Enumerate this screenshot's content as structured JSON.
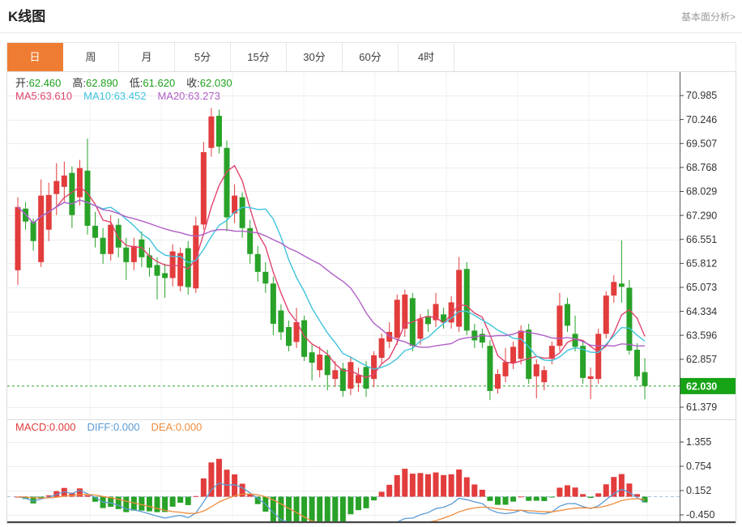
{
  "header": {
    "title": "K线图",
    "link_label": "基本面分析>"
  },
  "tabs": [
    {
      "key": "day",
      "label": "日",
      "active": true
    },
    {
      "key": "week",
      "label": "周",
      "active": false
    },
    {
      "key": "month",
      "label": "月",
      "active": false
    },
    {
      "key": "5min",
      "label": "5分",
      "active": false
    },
    {
      "key": "15min",
      "label": "15分",
      "active": false
    },
    {
      "key": "30min",
      "label": "30分",
      "active": false
    },
    {
      "key": "60min",
      "label": "60分",
      "active": false
    },
    {
      "key": "4hour",
      "label": "4时",
      "active": false
    }
  ],
  "quote_bar": [
    {
      "label": "开:",
      "value": "62.460"
    },
    {
      "label": "高:",
      "value": "62.890"
    },
    {
      "label": "低:",
      "value": "61.620"
    },
    {
      "label": "收:",
      "value": "62.030"
    }
  ],
  "ma_bar": [
    {
      "label": "MA5:",
      "value": "63.610",
      "color": "#e0446e"
    },
    {
      "label": "MA10:",
      "value": "63.452",
      "color": "#3ec3dc"
    },
    {
      "label": "MA20:",
      "value": "63.273",
      "color": "#b05fc6"
    }
  ],
  "macd_bar": [
    {
      "label": "MACD:",
      "value": "0.000",
      "color": "#e23c3c"
    },
    {
      "label": "DIFF:",
      "value": "0.000",
      "color": "#5b9bd5"
    },
    {
      "label": "DEA:",
      "value": "0.000",
      "color": "#f08c3c"
    }
  ],
  "colors": {
    "up": "#e23c3c",
    "down": "#28a228",
    "value_green": "#1ba11b",
    "badge_green": "#16a316",
    "tab_active": "#ee7d33",
    "axis": "#555555",
    "grid": "#ededed",
    "vgrid": "#f3f3f3",
    "ref_dash": "#2aa22a",
    "zero_dash": "#a9c4e4"
  },
  "chart_data": {
    "type": "candlestick",
    "title": "K线图 (daily K-line with MA5/MA10/MA20 and MACD sub-chart)",
    "y_axis": {
      "ticks": [
        "70.985",
        "70.246",
        "69.507",
        "68.768",
        "68.029",
        "67.290",
        "66.551",
        "65.812",
        "65.073",
        "64.334",
        "63.596",
        "62.857",
        "61.379"
      ],
      "current_price_badge": "62.030"
    },
    "reference_price": 62.03,
    "last_bar": {
      "open": 62.46,
      "high": 62.89,
      "low": 61.62,
      "close": 62.03
    },
    "candles_format": [
      "open",
      "high",
      "low",
      "close"
    ],
    "candles": [
      [
        65.6,
        67.85,
        65.15,
        67.55
      ],
      [
        67.5,
        67.7,
        66.85,
        67.1
      ],
      [
        67.1,
        67.2,
        66.2,
        66.5
      ],
      [
        65.85,
        68.4,
        65.7,
        67.9
      ],
      [
        66.85,
        68.3,
        66.5,
        67.92
      ],
      [
        67.95,
        68.9,
        67.3,
        68.35
      ],
      [
        68.17,
        68.95,
        67.72,
        68.52
      ],
      [
        68.6,
        68.8,
        66.9,
        67.3
      ],
      [
        67.85,
        69.0,
        67.6,
        68.75
      ],
      [
        68.67,
        69.66,
        66.7,
        66.97
      ],
      [
        66.97,
        67.4,
        66.3,
        66.6
      ],
      [
        66.6,
        66.9,
        65.8,
        66.1
      ],
      [
        66.1,
        67.3,
        65.9,
        67.0
      ],
      [
        67.0,
        67.2,
        66.0,
        66.3
      ],
      [
        66.3,
        66.6,
        65.3,
        65.85
      ],
      [
        65.85,
        66.6,
        65.6,
        66.35
      ],
      [
        66.55,
        66.8,
        65.7,
        66.0
      ],
      [
        66.06,
        66.3,
        65.4,
        65.68
      ],
      [
        65.76,
        66.0,
        64.7,
        65.43
      ],
      [
        65.51,
        65.8,
        64.75,
        65.36
      ],
      [
        65.36,
        66.4,
        65.1,
        66.18
      ],
      [
        65.11,
        66.3,
        64.95,
        66.13
      ],
      [
        66.28,
        66.5,
        64.85,
        65.08
      ],
      [
        65.04,
        67.25,
        64.9,
        66.98
      ],
      [
        67.01,
        69.55,
        66.85,
        69.24
      ],
      [
        69.37,
        70.6,
        69.1,
        70.34
      ],
      [
        70.36,
        70.55,
        69.2,
        69.41
      ],
      [
        69.37,
        69.6,
        66.8,
        67.23
      ],
      [
        67.35,
        68.25,
        67.05,
        67.9
      ],
      [
        67.85,
        68.0,
        66.6,
        66.9
      ],
      [
        66.9,
        67.15,
        65.8,
        66.1
      ],
      [
        66.1,
        66.35,
        65.25,
        65.55
      ],
      [
        65.55,
        65.85,
        64.9,
        65.19
      ],
      [
        65.19,
        65.4,
        63.6,
        63.95
      ],
      [
        64.36,
        64.55,
        63.45,
        63.69
      ],
      [
        63.85,
        64.05,
        63.1,
        63.27
      ],
      [
        63.39,
        64.44,
        63.2,
        64.0
      ],
      [
        64.06,
        64.2,
        62.8,
        62.93
      ],
      [
        63.07,
        63.3,
        62.2,
        62.75
      ],
      [
        62.52,
        63.25,
        62.3,
        63.0
      ],
      [
        62.98,
        63.15,
        61.9,
        62.37
      ],
      [
        62.25,
        62.8,
        62.0,
        62.52
      ],
      [
        62.57,
        62.75,
        61.7,
        61.88
      ],
      [
        61.95,
        62.95,
        61.75,
        62.77
      ],
      [
        62.12,
        62.6,
        61.85,
        62.37
      ],
      [
        62.62,
        62.8,
        61.7,
        61.95
      ],
      [
        62.25,
        63.1,
        62.0,
        62.98
      ],
      [
        62.9,
        63.65,
        62.7,
        63.5
      ],
      [
        63.4,
        64.0,
        63.2,
        63.7
      ],
      [
        63.52,
        64.85,
        63.3,
        64.69
      ],
      [
        63.8,
        65.0,
        63.55,
        64.85
      ],
      [
        64.74,
        64.9,
        63.1,
        63.27
      ],
      [
        63.49,
        64.25,
        63.3,
        64.11
      ],
      [
        64.19,
        64.4,
        63.7,
        63.94
      ],
      [
        64.06,
        64.9,
        63.85,
        64.56
      ],
      [
        64.24,
        64.45,
        63.8,
        63.99
      ],
      [
        63.99,
        64.8,
        63.8,
        64.61
      ],
      [
        63.86,
        66.01,
        63.7,
        65.61
      ],
      [
        65.64,
        65.85,
        63.6,
        63.74
      ],
      [
        63.74,
        63.95,
        63.2,
        63.44
      ],
      [
        63.64,
        63.8,
        63.2,
        63.37
      ],
      [
        63.27,
        63.45,
        61.6,
        61.88
      ],
      [
        61.95,
        62.55,
        61.8,
        62.4
      ],
      [
        62.33,
        63.2,
        62.15,
        62.77
      ],
      [
        62.75,
        63.4,
        62.55,
        63.24
      ],
      [
        62.87,
        63.9,
        62.7,
        63.74
      ],
      [
        63.77,
        63.95,
        62.1,
        62.25
      ],
      [
        62.33,
        62.85,
        61.65,
        62.7
      ],
      [
        62.15,
        62.65,
        61.9,
        62.52
      ],
      [
        62.87,
        63.4,
        62.7,
        63.27
      ],
      [
        63.27,
        64.9,
        63.1,
        64.51
      ],
      [
        64.56,
        64.75,
        63.7,
        63.89
      ],
      [
        63.64,
        64.2,
        63.1,
        63.24
      ],
      [
        63.27,
        63.45,
        62.1,
        62.28
      ],
      [
        62.25,
        62.6,
        61.63,
        62.33
      ],
      [
        62.25,
        63.8,
        62.1,
        63.64
      ],
      [
        63.64,
        64.95,
        63.5,
        64.82
      ],
      [
        64.82,
        65.45,
        64.6,
        65.24
      ],
      [
        65.19,
        66.52,
        64.6,
        65.09
      ],
      [
        65.06,
        65.3,
        63.0,
        63.12
      ],
      [
        63.15,
        63.35,
        62.2,
        62.33
      ],
      [
        62.46,
        62.89,
        61.62,
        62.03
      ]
    ],
    "moving_averages": [
      {
        "name": "MA5",
        "window": 5,
        "color": "#e0446e"
      },
      {
        "name": "MA10",
        "window": 10,
        "color": "#3ec3dc"
      },
      {
        "name": "MA20",
        "window": 20,
        "color": "#b05fc6"
      }
    ],
    "macd_panel": {
      "ticks": [
        "1.355",
        "0.754",
        "0.152",
        "-0.450"
      ],
      "diff_color": "#5b9bd5",
      "dea_color": "#f08c3c",
      "derived_from_closes": true
    }
  }
}
